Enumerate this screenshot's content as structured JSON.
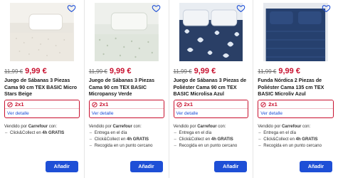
{
  "colors": {
    "price_red": "#c8102e",
    "link_blue": "#1e4fd6",
    "button_blue": "#1e4fd6"
  },
  "products": [
    {
      "old_price": "11,99 €",
      "price": "9,99 €",
      "title": "Juego de Sábanas 3 Piezas Cama 90 cm TEX BASIC Micro Stars Beige",
      "promo": "2x1",
      "promo_link": "Ver detalle",
      "seller_prefix": "Vendido por ",
      "seller": "Carrefour",
      "seller_suffix": " con:",
      "options": [
        {
          "pre": "Click&Collect en ",
          "bold": "4h GRATIS"
        }
      ],
      "button": "Añadir",
      "image_icon": "bed-sheets-beige-image"
    },
    {
      "old_price": "11,99 €",
      "price": "9,99 €",
      "title": "Juego de Sábanas 3 Piezas Cama 90 cm TEX BASIC Micropansy Verde",
      "promo": "2x1",
      "promo_link": "Ver detalle",
      "seller_prefix": "Vendido por ",
      "seller": "Carrefour",
      "seller_suffix": " con:",
      "options": [
        {
          "pre": "Entrega en el día",
          "bold": ""
        },
        {
          "pre": "Click&Collect en ",
          "bold": "4h GRATIS"
        },
        {
          "pre": "Recogida en un punto cercano",
          "bold": ""
        }
      ],
      "button": "Añadir",
      "image_icon": "bed-sheets-green-image"
    },
    {
      "old_price": "11,99 €",
      "price": "9,99 €",
      "title": "Juego de Sábanas 3 Piezas de Poliéster Cama 90 cm TEX BASIC Microlisa Azul",
      "promo": "2x1",
      "promo_link": "Ver detalle",
      "seller_prefix": "Vendido por ",
      "seller": "Carrefour",
      "seller_suffix": " con:",
      "options": [
        {
          "pre": "Entrega en el día",
          "bold": ""
        },
        {
          "pre": "Click&Collect en ",
          "bold": "4h GRATIS"
        },
        {
          "pre": "Recogida en un punto cercano",
          "bold": ""
        }
      ],
      "button": "Añadir",
      "image_icon": "bed-sheets-blue-pattern-image"
    },
    {
      "old_price": "11,99 €",
      "price": "9,99 €",
      "title": "Funda Nórdica 2 Piezas de Poliéster Cama 135 cm TEX BASIC Microliv Azul",
      "promo": "2x1",
      "promo_link": "Ver detalle",
      "seller_prefix": "Vendido por ",
      "seller": "Carrefour",
      "seller_suffix": " con:",
      "options": [
        {
          "pre": "Entrega en el día",
          "bold": ""
        },
        {
          "pre": "Click&Collect en ",
          "bold": "4h GRATIS"
        },
        {
          "pre": "Recogida en un punto cercano",
          "bold": ""
        }
      ],
      "button": "Añadir",
      "image_icon": "duvet-cover-navy-image"
    }
  ]
}
